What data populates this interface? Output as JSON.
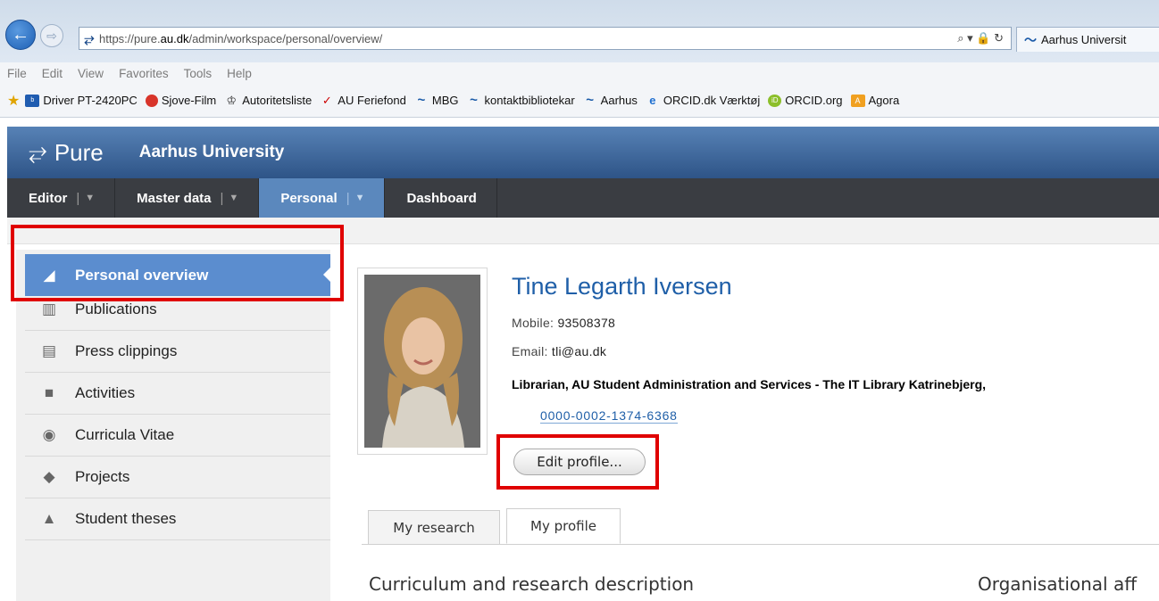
{
  "browser": {
    "url_prefix": "https://pure.",
    "url_domain": "au.dk",
    "url_path": "/admin/workspace/personal/overview/",
    "tab_title": "Aarhus Universit",
    "address_tools": "⌕ ▾ 🔒 ↻"
  },
  "menu": [
    "File",
    "Edit",
    "View",
    "Favorites",
    "Tools",
    "Help"
  ],
  "favorites": [
    {
      "label": "Driver PT-2420PC",
      "icon_color": "#1f5cb0",
      "icon_text": "b"
    },
    {
      "label": "Sjove-Film",
      "icon_color": "#d8342a",
      "icon_text": "●"
    },
    {
      "label": "Autoritetsliste",
      "icon_color": "#ffffff",
      "icon_text": "♔"
    },
    {
      "label": "AU Feriefond",
      "icon_color": "#ffffff",
      "icon_text": "✓"
    },
    {
      "label": "MBG",
      "icon_color": "#ffffff",
      "icon_text": "~"
    },
    {
      "label": "kontaktbibliotekar",
      "icon_color": "#ffffff",
      "icon_text": "~"
    },
    {
      "label": "Aarhus",
      "icon_color": "#ffffff",
      "icon_text": "~"
    },
    {
      "label": "ORCID.dk Værktøj",
      "icon_color": "#ffffff",
      "icon_text": "e"
    },
    {
      "label": "ORCID.org",
      "icon_color": "#8cbf2a",
      "icon_text": "iD"
    },
    {
      "label": "Agora",
      "icon_color": "#f0a020",
      "icon_text": "A"
    }
  ],
  "header": {
    "logo": "Pure",
    "organisation": "Aarhus University"
  },
  "topnav": [
    {
      "label": "Editor",
      "dropdown": true,
      "active": false
    },
    {
      "label": "Master data",
      "dropdown": true,
      "active": false
    },
    {
      "label": "Personal",
      "dropdown": true,
      "active": true
    },
    {
      "label": "Dashboard",
      "dropdown": false,
      "active": false
    }
  ],
  "sidebar": {
    "items": [
      {
        "label": "Personal overview",
        "icon": "personal-overview-icon"
      },
      {
        "label": "Publications",
        "icon": "book-icon"
      },
      {
        "label": "Press clippings",
        "icon": "newspaper-icon"
      },
      {
        "label": "Activities",
        "icon": "briefcase-icon"
      },
      {
        "label": "Curricula Vitae",
        "icon": "cv-icon"
      },
      {
        "label": "Projects",
        "icon": "cube-icon"
      },
      {
        "label": "Student theses",
        "icon": "graduation-cap-icon"
      }
    ]
  },
  "profile": {
    "name": "Tine Legarth Iversen",
    "mobile_label": "Mobile:",
    "mobile": "93508378",
    "email_label": "Email:",
    "email": "tli@au.dk",
    "role": "Librarian, AU Student Administration and Services - The IT Library Katrinebjerg,",
    "orcid": "0000-0002-1374-6368",
    "edit_button": "Edit profile..."
  },
  "tabs": [
    {
      "label": "My research",
      "active": false
    },
    {
      "label": "My profile",
      "active": true
    }
  ],
  "sections": {
    "left_title": "Curriculum and research description",
    "right_title": "Organisational aff"
  },
  "colors": {
    "highlight": "#e00000",
    "link": "#1f5fa8",
    "active_nav": "#5b88bd"
  }
}
